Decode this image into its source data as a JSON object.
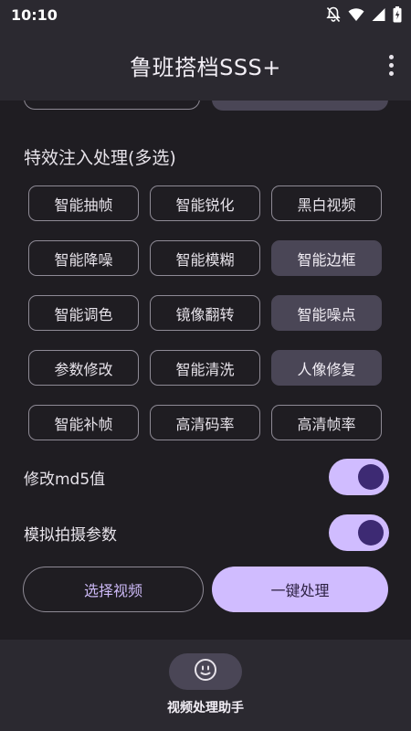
{
  "status_bar": {
    "time": "10:10",
    "icons": [
      "notifications-off-icon",
      "wifi-icon",
      "signal-icon",
      "battery-icon"
    ]
  },
  "app_bar": {
    "title": "鲁班搭档SSS+",
    "menu_icon": "more-vert-icon"
  },
  "effects": {
    "title": "特效注入处理(多选)",
    "chips": [
      {
        "label": "智能抽帧",
        "selected": false
      },
      {
        "label": "智能锐化",
        "selected": false
      },
      {
        "label": "黑白视频",
        "selected": false
      },
      {
        "label": "智能降噪",
        "selected": false
      },
      {
        "label": "智能模糊",
        "selected": false
      },
      {
        "label": "智能边框",
        "selected": true
      },
      {
        "label": "智能调色",
        "selected": false
      },
      {
        "label": "镜像翻转",
        "selected": false
      },
      {
        "label": "智能噪点",
        "selected": true
      },
      {
        "label": "参数修改",
        "selected": false
      },
      {
        "label": "智能清洗",
        "selected": false
      },
      {
        "label": "人像修复",
        "selected": true
      },
      {
        "label": "智能补帧",
        "selected": false
      },
      {
        "label": "高清码率",
        "selected": false
      },
      {
        "label": "高清帧率",
        "selected": false
      }
    ]
  },
  "switches": [
    {
      "label": "修改md5值",
      "checked": true
    },
    {
      "label": "模拟拍摄参数",
      "checked": true
    }
  ],
  "actions": {
    "select_video": "选择视频",
    "one_click_process": "一键处理"
  },
  "bottom_nav": {
    "items": [
      {
        "label": "视频处理助手",
        "icon": "smiley-face-icon",
        "active": true
      }
    ]
  },
  "colors": {
    "background": "#1f1d22",
    "surface": "#2b2930",
    "accent": "#d0bcff",
    "selected_chip": "#4a4656",
    "knob": "#3d2a73"
  }
}
